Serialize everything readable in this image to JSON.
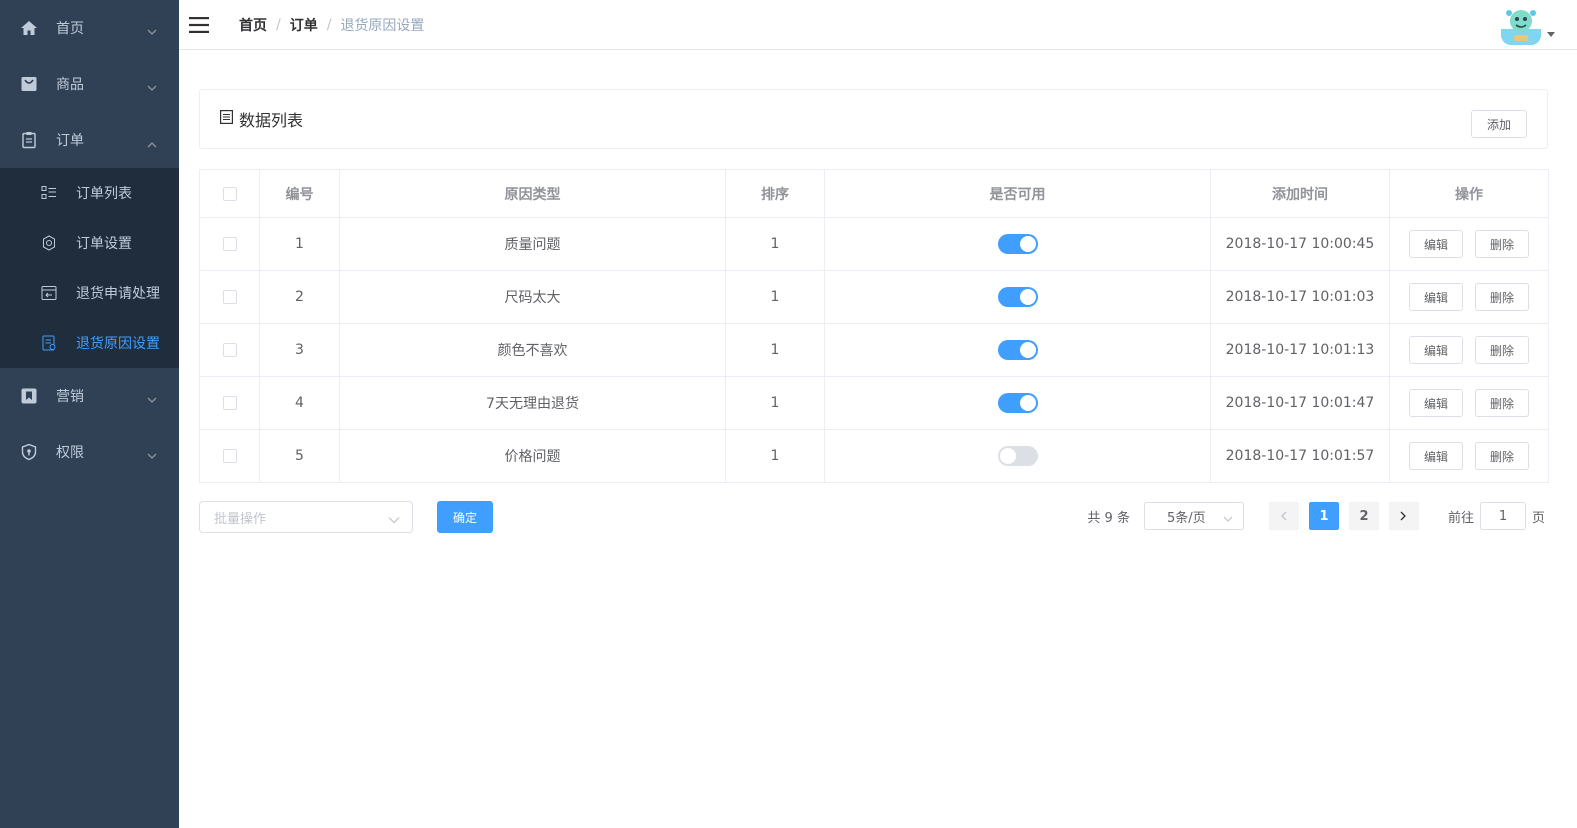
{
  "sidebar": {
    "menus": [
      {
        "label": "首页",
        "icon": "home-icon",
        "expanded": false
      },
      {
        "label": "商品",
        "icon": "shopping-bag-icon",
        "expanded": false
      },
      {
        "label": "订单",
        "icon": "clipboard-icon",
        "expanded": true
      },
      {
        "label": "营销",
        "icon": "bookmark-icon",
        "expanded": false
      },
      {
        "label": "权限",
        "icon": "shield-icon",
        "expanded": false
      }
    ],
    "order_submenu": [
      {
        "label": "订单列表",
        "icon": "list-icon"
      },
      {
        "label": "订单设置",
        "icon": "gear-icon"
      },
      {
        "label": "退货申请处理",
        "icon": "return-icon"
      },
      {
        "label": "退货原因设置",
        "icon": "document-icon",
        "active": true
      }
    ],
    "colors": {
      "bg": "#304156",
      "sub_bg": "#1f2d3d",
      "text": "#bfcbd9",
      "active": "#409EFF"
    }
  },
  "navbar": {
    "breadcrumb": [
      "首页",
      "订单",
      "退货原因设置"
    ],
    "separator": "/"
  },
  "panel": {
    "title": "数据列表",
    "add_label": "添加"
  },
  "table": {
    "columns": [
      "编号",
      "原因类型",
      "排序",
      "是否可用",
      "添加时间",
      "操作"
    ],
    "rows": [
      {
        "id": "1",
        "type": "质量问题",
        "sort": "1",
        "enabled": true,
        "time": "2018-10-17 10:00:45"
      },
      {
        "id": "2",
        "type": "尺码太大",
        "sort": "1",
        "enabled": true,
        "time": "2018-10-17 10:01:03"
      },
      {
        "id": "3",
        "type": "颜色不喜欢",
        "sort": "1",
        "enabled": true,
        "time": "2018-10-17 10:01:13"
      },
      {
        "id": "4",
        "type": "7天无理由退货",
        "sort": "1",
        "enabled": true,
        "time": "2018-10-17 10:01:47"
      },
      {
        "id": "5",
        "type": "价格问题",
        "sort": "1",
        "enabled": false,
        "time": "2018-10-17 10:01:57"
      }
    ],
    "edit_label": "编辑",
    "delete_label": "删除"
  },
  "batch": {
    "placeholder": "批量操作",
    "confirm_label": "确定"
  },
  "pagination": {
    "total_text": "共 9 条",
    "page_size": "5条/页",
    "pages": [
      "1",
      "2"
    ],
    "current": "1",
    "goto_prefix": "前往",
    "goto_value": "1",
    "goto_suffix": "页"
  },
  "accent_color": "#409EFF"
}
